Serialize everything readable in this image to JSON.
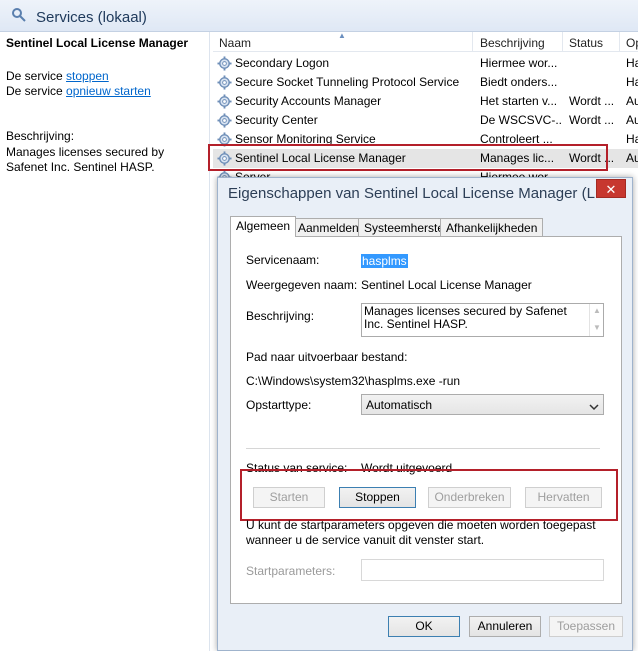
{
  "console": {
    "title": "Services (lokaal)",
    "left_pane": {
      "service_title": "Sentinel Local License Manager",
      "line1_prefix": "De service",
      "stop_link": "stoppen",
      "line2_prefix": "De service",
      "restart_link": "opnieuw starten",
      "description_label": "Beschrijving:",
      "description_text": "Manages licenses secured by Safenet Inc. Sentinel HASP."
    },
    "columns": [
      "Naam",
      "Beschrijving",
      "Status",
      "Op"
    ],
    "rows": [
      {
        "name": "Secondary Logon",
        "description": "Hiermee wor...",
        "status": "",
        "startup": "Ha"
      },
      {
        "name": "Secure Socket Tunneling Protocol Service",
        "description": "Biedt onders...",
        "status": "",
        "startup": "Ha"
      },
      {
        "name": "Security Accounts Manager",
        "description": "Het starten v...",
        "status": "Wordt ...",
        "startup": "Au"
      },
      {
        "name": "Security Center",
        "description": "De WSCSVC-...",
        "status": "Wordt ...",
        "startup": "Au"
      },
      {
        "name": "Sensor Monitoring Service",
        "description": "Controleert ...",
        "status": "",
        "startup": "Ha"
      },
      {
        "name": "Sentinel Local License Manager",
        "description": "Manages lic...",
        "status": "Wordt ...",
        "startup": "Au"
      },
      {
        "name": "Server",
        "description": "Hiermee wor...",
        "status": "",
        "startup": ""
      }
    ]
  },
  "dialog": {
    "title": "Eigenschappen van Sentinel Local License Manager (L...",
    "close_symbol": "✕",
    "tabs": [
      "Algemeen",
      "Aanmelden",
      "Systeemherstel",
      "Afhankelijkheden"
    ],
    "service_name_label": "Servicenaam:",
    "service_name_value": "hasplms",
    "display_name_label": "Weergegeven naam:",
    "display_name_value": "Sentinel Local License Manager",
    "description_label": "Beschrijving:",
    "description_value": "Manages licenses secured by Safenet Inc. Sentinel HASP.",
    "path_label": "Pad naar uitvoerbaar bestand:",
    "path_value": "C:\\Windows\\system32\\hasplms.exe  -run",
    "startup_type_label": "Opstarttype:",
    "startup_type_value": "Automatisch",
    "status_label": "Status van service:",
    "status_value": "Wordt uitgevoerd",
    "buttons": {
      "start": "Starten",
      "stop": "Stoppen",
      "pause": "Onderbreken",
      "resume": "Hervatten"
    },
    "note": "U kunt de startparameters opgeven die moeten worden toegepast wanneer u de service vanuit dit venster start.",
    "start_params_label": "Startparameters:",
    "start_params_value": "",
    "ok": "OK",
    "cancel": "Annuleren",
    "apply": "Toepassen"
  },
  "icons": {
    "service": "gear-icon",
    "close": "close-icon",
    "dropdown": "chevron-down-icon"
  },
  "colors": {
    "highlight_box": "#b4202a",
    "link": "#0066cc",
    "selection": "#3399ff"
  }
}
